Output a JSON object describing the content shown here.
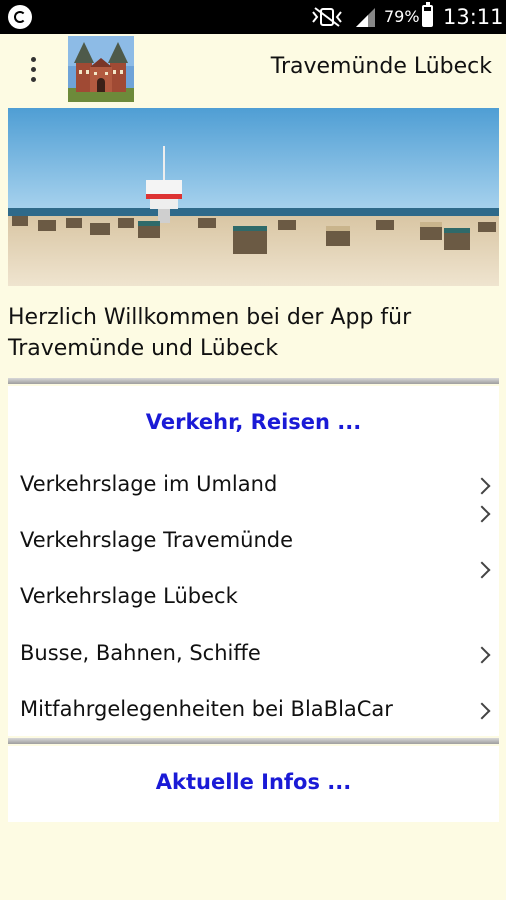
{
  "status_bar": {
    "battery": "79%",
    "time": "13:11"
  },
  "app_bar": {
    "title": "Travemünde Lübeck",
    "menu_icon": "more-vert-icon",
    "logo": "holstentor-logo"
  },
  "welcome_text": "Herzlich Willkommen bei der App für Travemünde und Lübeck",
  "sections": [
    {
      "title": "Verkehr, Reisen ...",
      "items": [
        {
          "label": "Verkehrslage im Umland"
        },
        {
          "label": "Verkehrslage Travemünde"
        },
        {
          "label": "Verkehrslage Lübeck"
        },
        {
          "label": "Busse, Bahnen, Schiffe"
        },
        {
          "label": "Mitfahrgelegenheiten bei BlaBlaCar"
        }
      ]
    },
    {
      "title": "Aktuelle Infos ..."
    }
  ],
  "colors": {
    "background": "#fdfbe3",
    "section_title": "#1a1ad6",
    "status_bar": "#000000"
  }
}
